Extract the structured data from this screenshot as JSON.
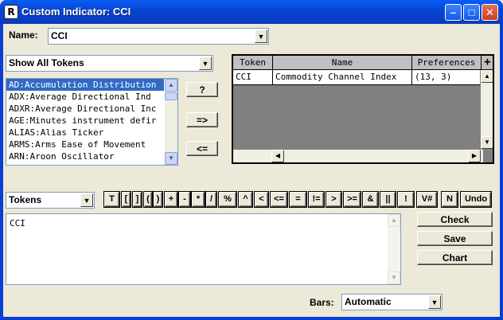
{
  "window": {
    "title": "Custom Indicator:  CCI",
    "minimize": "–",
    "maximize": "□",
    "close": "✕",
    "icon": "R"
  },
  "name": {
    "label": "Name:",
    "value": "CCI"
  },
  "filter": {
    "value": "Show All Tokens"
  },
  "token_list": [
    {
      "text": "AD:Accumulation Distribution",
      "selected": true
    },
    {
      "text": "ADX:Average Directional Ind"
    },
    {
      "text": "ADXR:Average Directional Inc"
    },
    {
      "text": "AGE:Minutes instrument defir"
    },
    {
      "text": "ALIAS:Alias Ticker"
    },
    {
      "text": "ARMS:Arms Ease of Movement"
    },
    {
      "text": "ARN:Aroon Oscillator"
    }
  ],
  "actions": {
    "help": "?",
    "add": "=>",
    "remove": "<="
  },
  "grid": {
    "headers": {
      "token": "Token",
      "name": "Name",
      "preferences": "Preferences",
      "add": "+"
    },
    "rows": [
      {
        "token": "CCI",
        "name": "Commodity Channel Index",
        "preferences": "(13, 3)"
      }
    ]
  },
  "tokens_combo": {
    "value": "Tokens"
  },
  "token_buttons": [
    "T",
    "[",
    "]",
    "(",
    ")",
    "+",
    "-",
    "*",
    "/",
    "%",
    "^",
    "<",
    "<=",
    "=",
    "!=",
    ">",
    ">=",
    "&",
    "||",
    "!",
    "V#",
    "N",
    "Undo"
  ],
  "formula": {
    "text": "CCI"
  },
  "side_buttons": {
    "check": "Check",
    "save": "Save",
    "chart": "Chart"
  },
  "bars": {
    "label": "Bars:",
    "value": "Automatic"
  },
  "icons": {
    "dropdown": "▼",
    "up": "▲",
    "down": "▼",
    "left": "◀",
    "right": "▶"
  }
}
